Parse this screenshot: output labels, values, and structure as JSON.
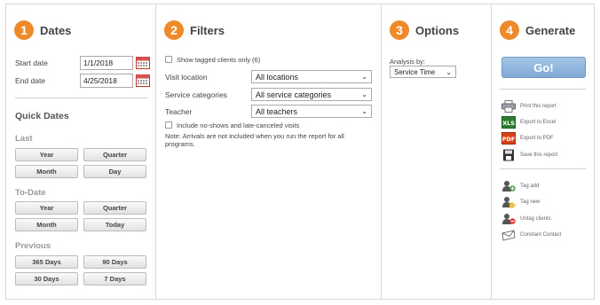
{
  "dates": {
    "step": "1",
    "title": "Dates",
    "start_label": "Start date",
    "start_value": "1/1/2018",
    "end_label": "End date",
    "end_value": "4/25/2018",
    "quick_title": "Quick Dates",
    "last_label": "Last",
    "last_buttons": [
      "Year",
      "Quarter",
      "Month",
      "Day"
    ],
    "todate_label": "To-Date",
    "todate_buttons": [
      "Year",
      "Quarter",
      "Month",
      "Today"
    ],
    "previous_label": "Previous",
    "previous_buttons": [
      "365 Days",
      "90 Days",
      "30 Days",
      "7 Days"
    ]
  },
  "filters": {
    "step": "2",
    "title": "Filters",
    "show_tagged": "Show tagged clients only (6)",
    "visit_location_label": "Visit location",
    "visit_location_value": "All locations",
    "service_categories_label": "Service categories",
    "service_categories_value": "All service categories",
    "teacher_label": "Teacher",
    "teacher_value": "All teachers",
    "include_noshows": "Include no-shows and late-canceled visits",
    "note_line1": "Note: Arrivals are not included when you run the report for all",
    "note_line2": "programs."
  },
  "options": {
    "step": "3",
    "title": "Options",
    "analysis_label": "Analysis by:",
    "analysis_value": "Service Time"
  },
  "generate": {
    "step": "4",
    "title": "Generate",
    "go_label": "Go!",
    "print": "Print this report",
    "excel": "Export to Excel",
    "excel_badge": "XLS",
    "pdf": "Export to PDF",
    "pdf_badge": "PDF",
    "save": "Save this report",
    "tag_add": "Tag add",
    "tag_new": "Tag new",
    "untag": "Untag clients",
    "constant_contact": "Constant Contact"
  },
  "colors": {
    "accent_orange": "#ee8a2a",
    "go_button_blue": "#8fb6de",
    "calendar_red": "#d9534f"
  }
}
